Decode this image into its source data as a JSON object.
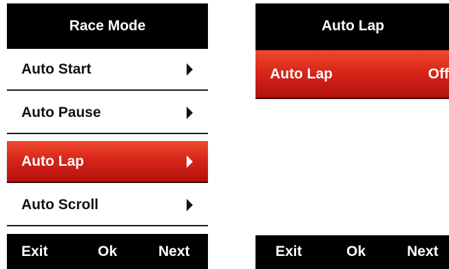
{
  "left_screen": {
    "title": "Race Mode",
    "items": [
      {
        "label": "Auto Start"
      },
      {
        "label": "Auto Pause"
      },
      {
        "label": "Auto Lap"
      },
      {
        "label": "Auto Scroll"
      }
    ],
    "selected_index": 2,
    "softkeys": {
      "exit": "Exit",
      "ok": "Ok",
      "next": "Next"
    }
  },
  "right_screen": {
    "title": "Auto Lap",
    "items": [
      {
        "label": "Auto Lap",
        "value": "Off"
      }
    ],
    "softkeys": {
      "exit": "Exit",
      "ok": "Ok",
      "next": "Next"
    }
  },
  "colors": {
    "selected_top": "#ef4a2e",
    "selected_bottom": "#b3110d",
    "bar_background": "#000000"
  },
  "icons": {
    "submenu_arrow": "chevron-right-icon"
  }
}
